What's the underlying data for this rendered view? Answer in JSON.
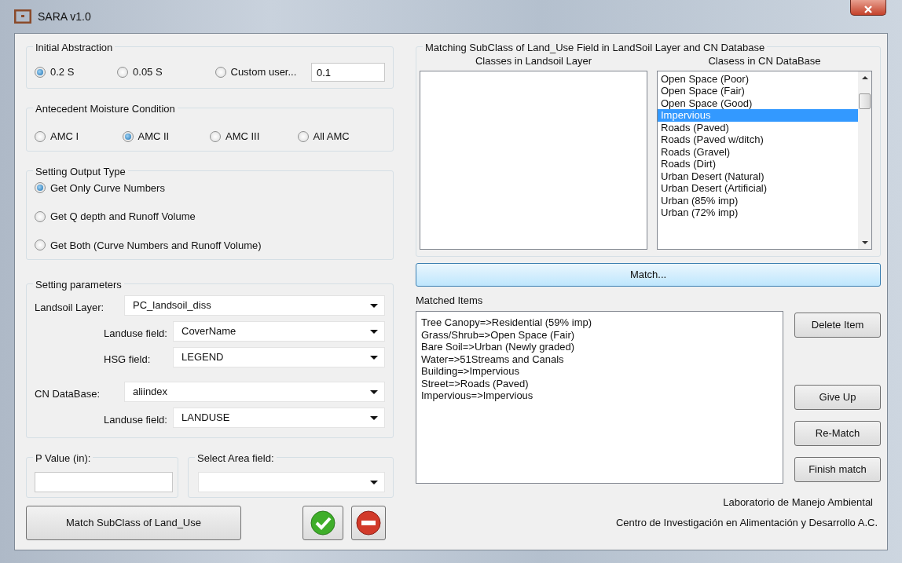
{
  "window": {
    "title": "SARA v1.0"
  },
  "initial_abstraction": {
    "title": "Initial Abstraction",
    "options": [
      {
        "label": "0.2 S",
        "selected": true
      },
      {
        "label": "0.05 S",
        "selected": false
      },
      {
        "label": "Custom user...",
        "selected": false
      }
    ],
    "custom_value": "0.1"
  },
  "moisture_condition": {
    "title": "Antecedent Moisture Condition",
    "options": [
      {
        "label": "AMC I",
        "selected": false
      },
      {
        "label": "AMC II",
        "selected": true
      },
      {
        "label": "AMC III",
        "selected": false
      },
      {
        "label": "All AMC",
        "selected": false
      }
    ]
  },
  "output_type": {
    "title": "Setting Output Type",
    "options": [
      {
        "label": "Get Only Curve Numbers",
        "selected": true
      },
      {
        "label": "Get Q depth and Runoff Volume",
        "selected": false
      },
      {
        "label": "Get Both (Curve Numbers and Runoff Volume)",
        "selected": false
      }
    ]
  },
  "parameters": {
    "title": "Setting parameters",
    "fields": [
      {
        "kind": "main",
        "label": "Landsoil Layer:",
        "value": "PC_landsoil_diss"
      },
      {
        "kind": "sub",
        "label": "Landuse field:",
        "value": "CoverName"
      },
      {
        "kind": "sub",
        "label": "HSG field:",
        "value": "LEGEND"
      },
      {
        "kind": "main",
        "label": "CN DataBase:",
        "value": "aliindex"
      },
      {
        "kind": "sub",
        "label": "Landuse field:",
        "value": "LANDUSE"
      }
    ]
  },
  "p_value": {
    "title": "P Value (in):"
  },
  "area_field": {
    "title": "Select Area field:"
  },
  "match_subclass_button": "Match SubClass of Land_Use",
  "matching": {
    "title": "Matching SubClass of Land_Use Field in LandSoil Layer and CN Database",
    "landsoil_header": "Classes in Landsoil Layer",
    "cn_header": "Clasess in CN DataBase",
    "cn_classes": [
      {
        "label": "Open Space (Poor)",
        "selected": false
      },
      {
        "label": "Open Space (Fair)",
        "selected": false
      },
      {
        "label": "Open Space (Good)",
        "selected": false
      },
      {
        "label": "Impervious",
        "selected": true
      },
      {
        "label": "Roads (Paved)",
        "selected": false
      },
      {
        "label": "Roads (Paved w/ditch)",
        "selected": false
      },
      {
        "label": "Roads (Gravel)",
        "selected": false
      },
      {
        "label": "Roads (Dirt)",
        "selected": false
      },
      {
        "label": "Urban Desert (Natural)",
        "selected": false
      },
      {
        "label": "Urban Desert (Artificial)",
        "selected": false
      },
      {
        "label": "Urban (85% imp)",
        "selected": false
      },
      {
        "label": "Urban (72% imp)",
        "selected": false
      }
    ]
  },
  "match_button": "Match...",
  "matched_items": {
    "title": "Matched Items",
    "items": [
      "Tree Canopy=>Residential (59% imp)",
      "Grass/Shrub=>Open Space (Fair)",
      "Bare Soil=>Urban (Newly graded)",
      "Water=>51Streams and Canals",
      "Building=>Impervious",
      "Street=>Roads (Paved)",
      "Impervious=>Impervious"
    ]
  },
  "side_buttons": [
    {
      "label": "Delete Item",
      "kind": "top"
    },
    {
      "label": "Give Up",
      "kind": "bottom"
    },
    {
      "label": "Re-Match",
      "kind": "bottom"
    },
    {
      "label": "Finish match",
      "kind": "bottom"
    }
  ],
  "credits": [
    "Laboratorio de Manejo Ambiental",
    "Centro de Investigación en Alimentación y Desarrollo A.C."
  ]
}
